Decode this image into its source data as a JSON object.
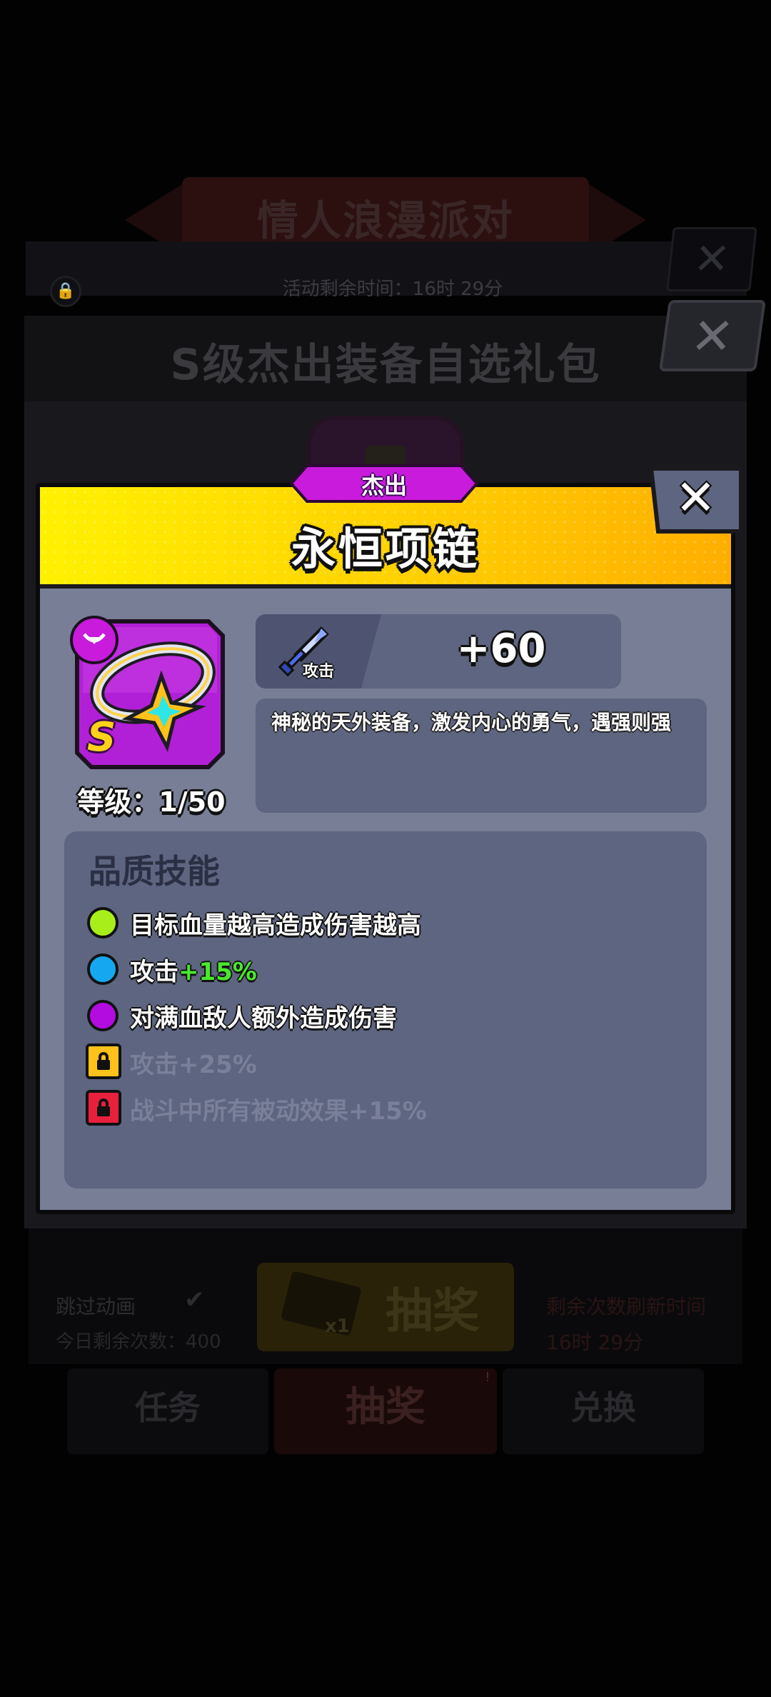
{
  "background": {
    "event_title": "情人浪漫派对",
    "event_timer": "活动剩余时间：16时 29分",
    "gift_pack_title": "S级杰出装备自选礼包",
    "skip_animation": "跳过动画",
    "today_remaining": "今日剩余次数：400",
    "draw_label": "抽奖",
    "draw_ticket_count": "x1",
    "refresh_label": "剩余次数刷新时间",
    "refresh_time": "16时 29分",
    "tabs": [
      {
        "label": "任务"
      },
      {
        "label": "抽奖"
      },
      {
        "label": "兑换"
      }
    ],
    "tab_badge": "!"
  },
  "dialog": {
    "rarity": "杰出",
    "title": "永恒项链",
    "grade": "S",
    "level": "等级：1/50",
    "stat": {
      "name": "攻击",
      "value": "+60"
    },
    "description": "神秘的天外装备，激发内心的勇气，遇强则强",
    "skills_title": "品质技能",
    "skills": [
      {
        "text": "目标血量越高造成伤害越高",
        "highlight": "",
        "dot_color": "#a8ee1a",
        "locked": false
      },
      {
        "text": "攻击",
        "highlight": "+15%",
        "dot_color": "#15a8f0",
        "locked": false
      },
      {
        "text": "对满血敌人额外造成伤害",
        "highlight": "",
        "dot_color": "#b30ce0",
        "locked": false
      },
      {
        "text": "攻击+25%",
        "highlight": "",
        "dot_color": "#ffc21a",
        "locked": true
      },
      {
        "text": "战斗中所有被动效果+15%",
        "highlight": "",
        "dot_color": "#e8203c",
        "locked": true
      }
    ]
  },
  "colors": {
    "header_yellow": "#ffd200",
    "rarity_purple": "#c81bdc",
    "panel_slate": "#787e96",
    "highlight_green": "#4ae82c"
  }
}
